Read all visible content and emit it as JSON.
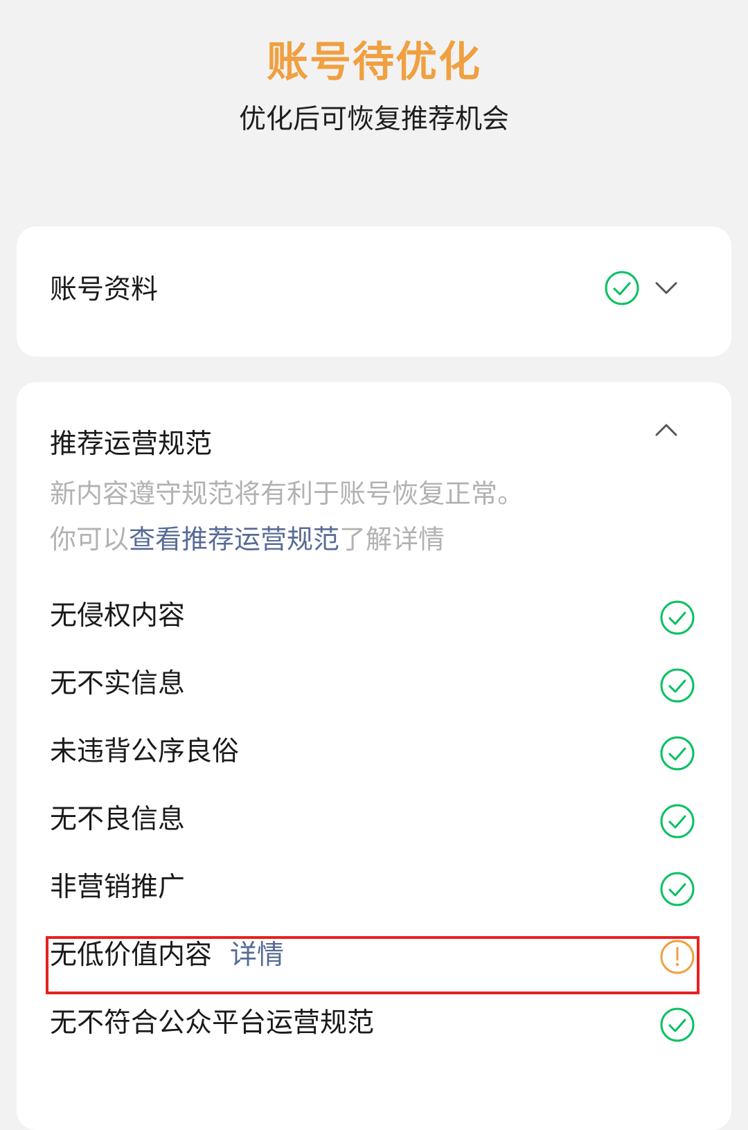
{
  "header": {
    "title": "账号待优化",
    "subtitle": "优化后可恢复推荐机会"
  },
  "profile_card": {
    "title": "账号资料",
    "status_icon": "check-circle-icon",
    "toggle_icon": "chevron-down-icon"
  },
  "rules_card": {
    "title": "推荐运营规范",
    "toggle_icon": "chevron-up-icon",
    "desc_line1": "新内容遵守规范将有利于账号恢复正常。",
    "desc_line2_prefix": "你可以",
    "desc_line2_link": "查看推荐运营规范",
    "desc_line2_suffix": "了解详情",
    "items": [
      {
        "label": "无侵权内容",
        "status": "pass"
      },
      {
        "label": "无不实信息",
        "status": "pass"
      },
      {
        "label": "未违背公序良俗",
        "status": "pass"
      },
      {
        "label": "无不良信息",
        "status": "pass"
      },
      {
        "label": "非营销推广",
        "status": "pass"
      },
      {
        "label": "无低价值内容",
        "detail_link": "详情",
        "status": "warning"
      },
      {
        "label": "无不符合公众平台运营规范",
        "status": "pass"
      }
    ]
  },
  "colors": {
    "title_orange": "#f0a040",
    "pass_green": "#07c160",
    "warning_orange": "#f0a040",
    "link_blue": "#576b95",
    "highlight_red": "#e8201e"
  }
}
